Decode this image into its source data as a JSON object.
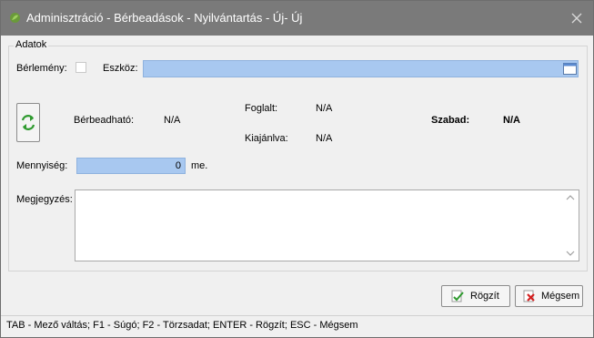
{
  "window": {
    "title": "Adminisztráció - Bérbeadások - Nyilvántartás - Új- Új",
    "close_glyph": "✕"
  },
  "group": {
    "legend": "Adatok"
  },
  "form": {
    "berlemeny_label": "Bérlemény:",
    "berlemeny_checked": false,
    "eszkoz_label": "Eszköz:",
    "eszkoz_value": "",
    "berbeadhato_label": "Bérbeadható:",
    "berbeadhato_value": "N/A",
    "foglalt_label": "Foglalt:",
    "foglalt_value": "N/A",
    "kiajanlva_label": "Kiajánlva:",
    "kiajanlva_value": "N/A",
    "szabad_label": "Szabad:",
    "szabad_value": "N/A",
    "mennyiseg_label": "Mennyiség:",
    "mennyiseg_value": "0",
    "mennyiseg_unit": "me.",
    "megjegyzes_label": "Megjegyzés:",
    "megjegyzes_value": ""
  },
  "buttons": {
    "save_label": "Rögzít",
    "cancel_label": "Mégsem"
  },
  "statusbar": {
    "text": "TAB - Mező váltás; F1 - Súgó; F2 - Törzsadat; ENTER - Rögzít; ESC - Mégsem"
  },
  "colors": {
    "titlebar": "#7a7a7a",
    "required_field": "#a8c8f0",
    "window_bg": "#f0f0f0"
  },
  "icons": {
    "app": "app-leaf-icon",
    "picker": "calendar-picker-icon",
    "refresh": "refresh-arrows-icon",
    "save": "checkmark-document-icon",
    "cancel": "red-x-document-icon"
  }
}
